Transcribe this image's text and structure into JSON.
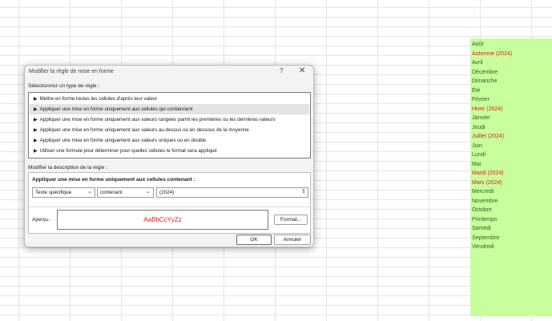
{
  "dialog": {
    "title": "Modifier la règle de mise en forme",
    "help": "?",
    "close": "✕",
    "select_type_label": "Sélectionnez un type de règle :",
    "rule_types": [
      "Mettre en forme toutes les cellules d'après leur valeur",
      "Appliquer une mise en forme uniquement aux cellules qui contiennent",
      "Appliquer une mise en forme uniquement aux valeurs rangées parmi les premières ou les dernières valeurs",
      "Appliquer une mise en forme uniquement aux valeurs au-dessus ou en dessous de la moyenne",
      "Appliquer une mise en forme uniquement aux valeurs uniques ou en double",
      "Utiliser une formule pour déterminer pour quelles cellules le format sera appliqué"
    ],
    "selected_rule_index": 1,
    "edit_desc_label": "Modifier la description de la règle :",
    "format_only_label": "Appliquer une mise en forme uniquement aux cellules contenant :",
    "condition_type": "Texte spécifique",
    "operator": "contenant",
    "value": "(2024)",
    "preview_label": "Aperçu :",
    "preview_text": "AaBbCcYyZz",
    "format_button": "Format...",
    "ok_button": "OK",
    "cancel_button": "Annuler"
  },
  "sheet": {
    "highlight_color": "#c8ff9c",
    "match_text_color": "#e0201a",
    "cells": [
      {
        "text": "Août",
        "match": false
      },
      {
        "text": "Automne (2024)",
        "match": true
      },
      {
        "text": "Avril",
        "match": false
      },
      {
        "text": "Décembre",
        "match": false
      },
      {
        "text": "Dimanche",
        "match": false
      },
      {
        "text": "Été",
        "match": false
      },
      {
        "text": "Février",
        "match": false
      },
      {
        "text": "Hiver (2024)",
        "match": true
      },
      {
        "text": "Janvier",
        "match": false
      },
      {
        "text": "Jeudi",
        "match": false
      },
      {
        "text": "Juillet (2024)",
        "match": true
      },
      {
        "text": "Juin",
        "match": false
      },
      {
        "text": "Lundi",
        "match": false
      },
      {
        "text": "Mai",
        "match": false
      },
      {
        "text": "Mardi (2024)",
        "match": true
      },
      {
        "text": "Mars (2024)",
        "match": true
      },
      {
        "text": "Mercredi",
        "match": false
      },
      {
        "text": "Novembre",
        "match": false
      },
      {
        "text": "Octobre",
        "match": false
      },
      {
        "text": "Printemps",
        "match": false
      },
      {
        "text": "Samedi",
        "match": false
      },
      {
        "text": "Septembre",
        "match": false
      },
      {
        "text": "Vendredi",
        "match": false
      }
    ]
  }
}
